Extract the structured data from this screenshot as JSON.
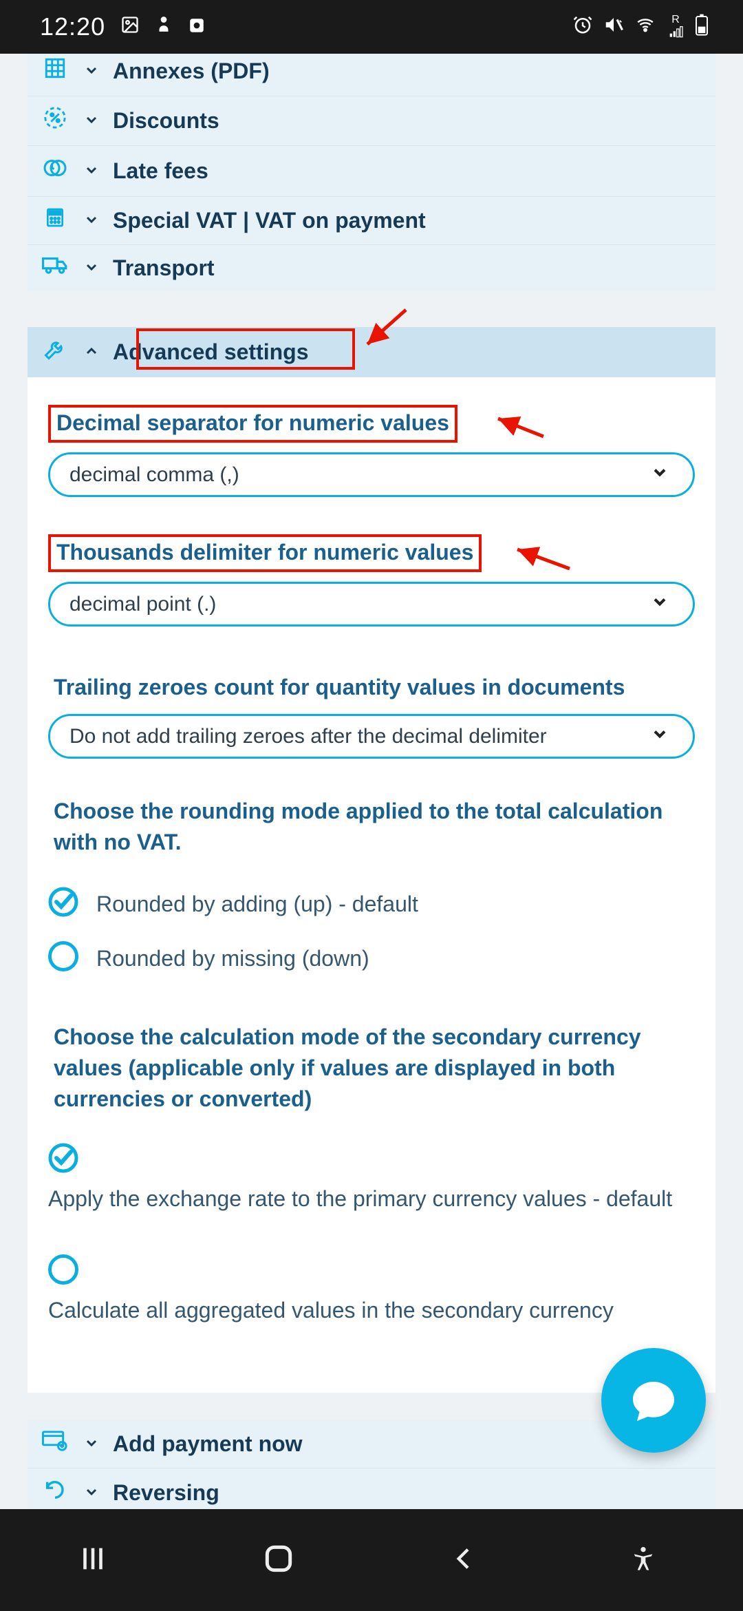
{
  "status": {
    "time": "12:20",
    "right_label": "R"
  },
  "accordion": {
    "annexes": "Annexes (PDF)",
    "discounts": "Discounts",
    "late_fees": "Late fees",
    "vat": "Special VAT | VAT on payment",
    "transport": "Transport",
    "advanced": "Advanced settings",
    "add_payment": "Add payment now",
    "reversing": "Reversing"
  },
  "fields": {
    "decimal_sep": {
      "label": "Decimal separator for numeric values",
      "value": "decimal comma (,)"
    },
    "thousands": {
      "label": "Thousands delimiter for numeric values",
      "value": "decimal point (.)"
    },
    "trailing": {
      "label": "Trailing zeroes count for quantity values in documents",
      "value": "Do not add trailing zeroes after the decimal delimiter"
    }
  },
  "rounding": {
    "title": "Choose the rounding mode applied to the total calculation with no VAT.",
    "opt_up": "Rounded by adding (up) - default",
    "opt_down": "Rounded by missing (down)"
  },
  "secondary": {
    "title": "Choose the calculation mode of the secondary currency values (applicable only if values are displayed in both currencies or converted)",
    "opt_primary": "Apply the exchange rate to the primary currency values - default",
    "opt_secondary": "Calculate all aggregated values in the secondary currency"
  }
}
